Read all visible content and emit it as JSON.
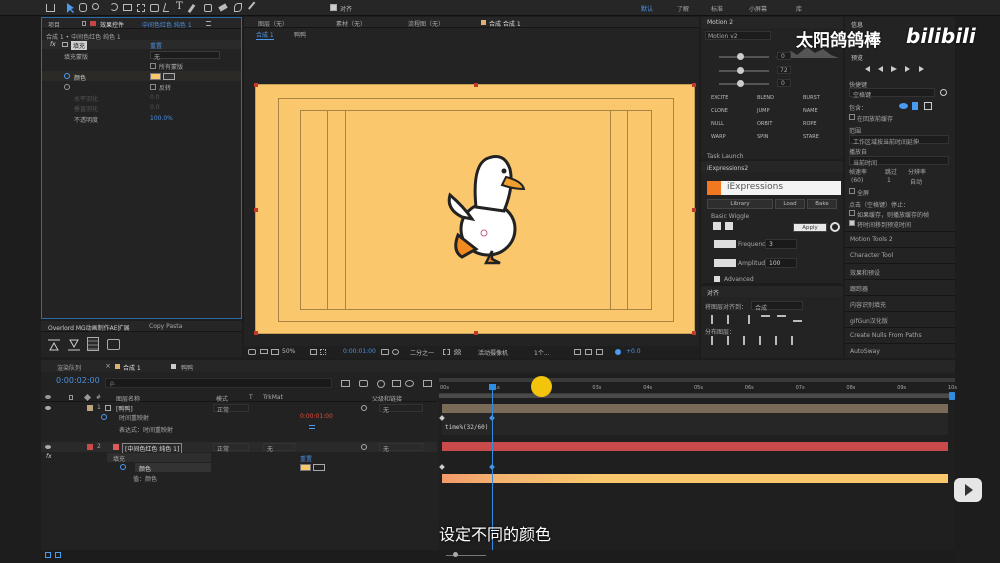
{
  "toolbar": {
    "align_label": "对齐",
    "workspaces": [
      "默认",
      "了解",
      "标准",
      "小屏幕",
      "库"
    ]
  },
  "project_panel": {
    "tab_project": "项目",
    "tab_effects": "效果控件",
    "tab_effects_layer": "中间色红色 纯色 1",
    "breadcrumb": "合成 1 • 中间色红色 纯色 1",
    "effect_name": "填充",
    "reset_label": "重置",
    "rows": [
      {
        "label": "填充蒙版",
        "value": "无"
      },
      {
        "label": "",
        "value": "所有蒙版"
      },
      {
        "label": "颜色",
        "value": ""
      },
      {
        "label": "",
        "value": "反转"
      },
      {
        "label": "水平羽化",
        "value": "0.0"
      },
      {
        "label": "垂直羽化",
        "value": "0.0"
      },
      {
        "label": "不透明度",
        "value": "100.0%"
      }
    ],
    "fx_label": "fx",
    "layer_num": "1"
  },
  "ext_tabs": {
    "tab1": "Overlord MG动画制作AE扩展",
    "tab2": "Copy Pasta"
  },
  "viewer": {
    "layer_tab": "图层（无）",
    "material_tab": "素材（无）",
    "tree_tab": "流程图（无）",
    "comp_tab": "合成 合成 1",
    "subtab_comp": "合成 1",
    "subtab_duck": "鸭鸭",
    "zoom": "50%",
    "timecode": "0:00:01:00",
    "quality": "二分之一",
    "camera": "活动摄像机",
    "views": "1个...",
    "offset": "+0.0"
  },
  "right_panels": {
    "motion_title": "Motion 2",
    "motion_version": "Motion v2",
    "motion_values": [
      "0",
      "72",
      "0"
    ],
    "motion_buttons": [
      "EXCITE",
      "BLEND",
      "BURST",
      "CLONE",
      "JUMP",
      "NAME",
      "NULL",
      "ORBIT",
      "ROPE",
      "WARP",
      "SPIN",
      "STARE"
    ],
    "task_label": "Task Launch",
    "iexp_title": "iExpressions2",
    "iexp_logo": "iExpressions",
    "iexp_tabs": [
      "Library",
      "Load",
      "Bake"
    ],
    "iexp_preset": "Basic Wiggle",
    "iexp_apply": "Apply",
    "frequency_label": "Frequency",
    "frequency_value": "3",
    "amplitude_label": "Amplitude",
    "amplitude_value": "100",
    "advanced_label": "Advanced",
    "align_title": "对齐",
    "align_to_label": "将图层对齐到：",
    "align_to_value": "合成",
    "distribute_label": "分布图层："
  },
  "far_right": {
    "info": "信息",
    "preview": "预览",
    "shortcut_label": "快捷键",
    "shortcut_value": "空格键",
    "include_label": "包含：",
    "cache_label": "在回放前缓存",
    "range_label": "范围",
    "range_value": "工作区域按当前时间延伸",
    "playfrom_label": "播放自",
    "playfrom_value": "当前时间",
    "fps_label": "帧速率",
    "skip_label": "跳过",
    "res_label": "分辨率",
    "fps_value": "(60)",
    "skip_value": "1",
    "res_value": "自动",
    "fullscreen_label": "全屏",
    "click_stop_label": "点击（空格键）停止：",
    "cache_option": "如果缓存，则播放缓存的帧",
    "time_option": "将时间移到预览时间",
    "list": [
      "Motion Tools 2",
      "Character Tool",
      "效果和预设",
      "跟踪器",
      "内容识别填充",
      "gifGun汉化版",
      "Create Nulls From Paths",
      "AutoSway"
    ]
  },
  "watermark": {
    "text": "太阳鸽鸽棒",
    "logo": "bilibili"
  },
  "timeline": {
    "tab_render": "渲染队列",
    "tab_comp": "合成 1",
    "tab_duck": "鸭鸭",
    "timecode": "0:00:02:00",
    "search_placeholder": "ρ.",
    "col_num": "#",
    "col_name": "图层名称",
    "col_mode": "模式",
    "col_t": "T",
    "col_trkmat": "TrkMat",
    "col_parent": "父级和链接",
    "ruler": [
      "00s",
      "01s",
      "02s",
      "03s",
      "04s",
      "05s",
      "06s",
      "07s",
      "08s",
      "09s",
      "10s"
    ],
    "layer1": {
      "num": "1",
      "name": "[鸭鸭]",
      "mode": "正常",
      "parent": "无"
    },
    "layer1_prop": "时间重映射",
    "layer1_value": "0:00:01:00",
    "layer1_expr_label": "表达式：时间重映射",
    "layer1_expr": "time%(32/60)",
    "layer2": {
      "num": "2",
      "name": "[中间色红色 纯色 1]",
      "mode": "正常",
      "trkmat": "无",
      "parent": "无"
    },
    "effect_fill": "填充",
    "effect_reset": "重置",
    "prop_color": "颜色",
    "prop_value_label": "值：颜色"
  },
  "subtitle": "设定不同的颜色",
  "colors": {
    "canvas": "#fac76c",
    "accent_blue": "#2f8ce0",
    "playhead": "#f2c40c",
    "layer_red": "#c94a4a",
    "layer_tan": "#7a6a58"
  }
}
